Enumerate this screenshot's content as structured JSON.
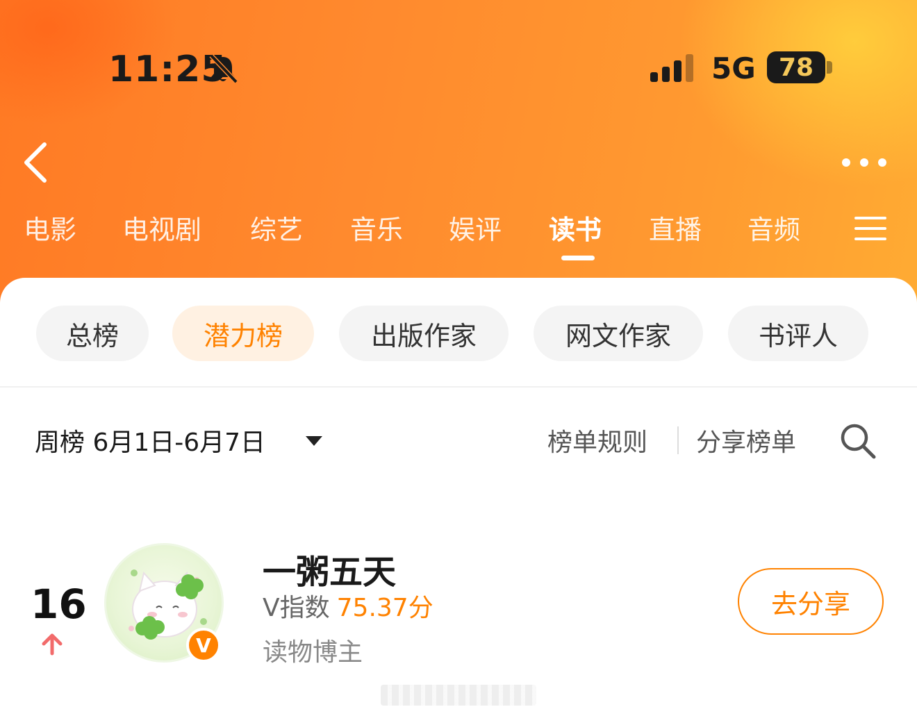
{
  "status_bar": {
    "time": "11:25",
    "network": "5G",
    "battery": "78",
    "icons": [
      "bell-muted-icon",
      "signal-icon"
    ]
  },
  "nav": {
    "back_icon": "chevron-left-icon",
    "more_icon": "more-dots-icon",
    "menu_icon": "menu-lines-icon",
    "tabs": [
      {
        "label": "电影"
      },
      {
        "label": "电视剧"
      },
      {
        "label": "综艺"
      },
      {
        "label": "音乐"
      },
      {
        "label": "娱评"
      },
      {
        "label": "读书",
        "active": true
      },
      {
        "label": "直播"
      },
      {
        "label": "音频"
      }
    ]
  },
  "chips": [
    {
      "label": "总榜"
    },
    {
      "label": "潜力榜",
      "active": true
    },
    {
      "label": "出版作家"
    },
    {
      "label": "网文作家"
    },
    {
      "label": "书评人"
    }
  ],
  "toolbar": {
    "period": "周榜 6月1日-6月7日",
    "rules": "榜单规则",
    "share_list": "分享榜单"
  },
  "entry": {
    "rank": "16",
    "rank_trend": "up",
    "name": "一粥五天",
    "vindex_label": "V指数",
    "vindex_score": "75.37分",
    "role": "读物博主",
    "badge": "V",
    "share_button": "去分享"
  },
  "colors": {
    "accent": "#ff8200",
    "header_start": "#ff7a24",
    "header_end": "#ffab33",
    "rank_up": "#f26b6b"
  }
}
